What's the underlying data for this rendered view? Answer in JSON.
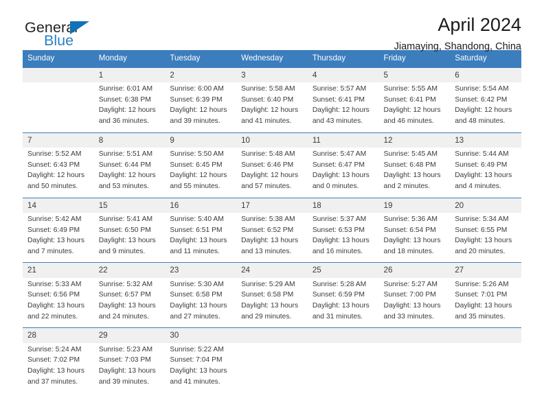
{
  "logo": {
    "word_top": "General",
    "word_bottom": "Blue",
    "triangle_color": "#1272b7",
    "blue_color": "#2980c4"
  },
  "header": {
    "title": "April 2024",
    "subtitle": "Jiamaying, Shandong, China"
  },
  "theme": {
    "header_bg": "#3b7dbd",
    "daynum_bg": "#f0f0f0",
    "text": "#3a3a3a"
  },
  "weekday_headers": [
    "Sunday",
    "Monday",
    "Tuesday",
    "Wednesday",
    "Thursday",
    "Friday",
    "Saturday"
  ],
  "labels": {
    "sunrise_prefix": "Sunrise:",
    "sunset_prefix": "Sunset:",
    "daylight_prefix": "Daylight:"
  },
  "weeks": [
    [
      {
        "day": "",
        "sunrise": "",
        "sunset": "",
        "daylight_line1": "",
        "daylight_line2": "",
        "blank": true
      },
      {
        "day": "1",
        "sunrise": "Sunrise: 6:01 AM",
        "sunset": "Sunset: 6:38 PM",
        "daylight_line1": "Daylight: 12 hours",
        "daylight_line2": "and 36 minutes."
      },
      {
        "day": "2",
        "sunrise": "Sunrise: 6:00 AM",
        "sunset": "Sunset: 6:39 PM",
        "daylight_line1": "Daylight: 12 hours",
        "daylight_line2": "and 39 minutes."
      },
      {
        "day": "3",
        "sunrise": "Sunrise: 5:58 AM",
        "sunset": "Sunset: 6:40 PM",
        "daylight_line1": "Daylight: 12 hours",
        "daylight_line2": "and 41 minutes."
      },
      {
        "day": "4",
        "sunrise": "Sunrise: 5:57 AM",
        "sunset": "Sunset: 6:41 PM",
        "daylight_line1": "Daylight: 12 hours",
        "daylight_line2": "and 43 minutes."
      },
      {
        "day": "5",
        "sunrise": "Sunrise: 5:55 AM",
        "sunset": "Sunset: 6:41 PM",
        "daylight_line1": "Daylight: 12 hours",
        "daylight_line2": "and 46 minutes."
      },
      {
        "day": "6",
        "sunrise": "Sunrise: 5:54 AM",
        "sunset": "Sunset: 6:42 PM",
        "daylight_line1": "Daylight: 12 hours",
        "daylight_line2": "and 48 minutes."
      }
    ],
    [
      {
        "day": "7",
        "sunrise": "Sunrise: 5:52 AM",
        "sunset": "Sunset: 6:43 PM",
        "daylight_line1": "Daylight: 12 hours",
        "daylight_line2": "and 50 minutes."
      },
      {
        "day": "8",
        "sunrise": "Sunrise: 5:51 AM",
        "sunset": "Sunset: 6:44 PM",
        "daylight_line1": "Daylight: 12 hours",
        "daylight_line2": "and 53 minutes."
      },
      {
        "day": "9",
        "sunrise": "Sunrise: 5:50 AM",
        "sunset": "Sunset: 6:45 PM",
        "daylight_line1": "Daylight: 12 hours",
        "daylight_line2": "and 55 minutes."
      },
      {
        "day": "10",
        "sunrise": "Sunrise: 5:48 AM",
        "sunset": "Sunset: 6:46 PM",
        "daylight_line1": "Daylight: 12 hours",
        "daylight_line2": "and 57 minutes."
      },
      {
        "day": "11",
        "sunrise": "Sunrise: 5:47 AM",
        "sunset": "Sunset: 6:47 PM",
        "daylight_line1": "Daylight: 13 hours",
        "daylight_line2": "and 0 minutes."
      },
      {
        "day": "12",
        "sunrise": "Sunrise: 5:45 AM",
        "sunset": "Sunset: 6:48 PM",
        "daylight_line1": "Daylight: 13 hours",
        "daylight_line2": "and 2 minutes."
      },
      {
        "day": "13",
        "sunrise": "Sunrise: 5:44 AM",
        "sunset": "Sunset: 6:49 PM",
        "daylight_line1": "Daylight: 13 hours",
        "daylight_line2": "and 4 minutes."
      }
    ],
    [
      {
        "day": "14",
        "sunrise": "Sunrise: 5:42 AM",
        "sunset": "Sunset: 6:49 PM",
        "daylight_line1": "Daylight: 13 hours",
        "daylight_line2": "and 7 minutes."
      },
      {
        "day": "15",
        "sunrise": "Sunrise: 5:41 AM",
        "sunset": "Sunset: 6:50 PM",
        "daylight_line1": "Daylight: 13 hours",
        "daylight_line2": "and 9 minutes."
      },
      {
        "day": "16",
        "sunrise": "Sunrise: 5:40 AM",
        "sunset": "Sunset: 6:51 PM",
        "daylight_line1": "Daylight: 13 hours",
        "daylight_line2": "and 11 minutes."
      },
      {
        "day": "17",
        "sunrise": "Sunrise: 5:38 AM",
        "sunset": "Sunset: 6:52 PM",
        "daylight_line1": "Daylight: 13 hours",
        "daylight_line2": "and 13 minutes."
      },
      {
        "day": "18",
        "sunrise": "Sunrise: 5:37 AM",
        "sunset": "Sunset: 6:53 PM",
        "daylight_line1": "Daylight: 13 hours",
        "daylight_line2": "and 16 minutes."
      },
      {
        "day": "19",
        "sunrise": "Sunrise: 5:36 AM",
        "sunset": "Sunset: 6:54 PM",
        "daylight_line1": "Daylight: 13 hours",
        "daylight_line2": "and 18 minutes."
      },
      {
        "day": "20",
        "sunrise": "Sunrise: 5:34 AM",
        "sunset": "Sunset: 6:55 PM",
        "daylight_line1": "Daylight: 13 hours",
        "daylight_line2": "and 20 minutes."
      }
    ],
    [
      {
        "day": "21",
        "sunrise": "Sunrise: 5:33 AM",
        "sunset": "Sunset: 6:56 PM",
        "daylight_line1": "Daylight: 13 hours",
        "daylight_line2": "and 22 minutes."
      },
      {
        "day": "22",
        "sunrise": "Sunrise: 5:32 AM",
        "sunset": "Sunset: 6:57 PM",
        "daylight_line1": "Daylight: 13 hours",
        "daylight_line2": "and 24 minutes."
      },
      {
        "day": "23",
        "sunrise": "Sunrise: 5:30 AM",
        "sunset": "Sunset: 6:58 PM",
        "daylight_line1": "Daylight: 13 hours",
        "daylight_line2": "and 27 minutes."
      },
      {
        "day": "24",
        "sunrise": "Sunrise: 5:29 AM",
        "sunset": "Sunset: 6:58 PM",
        "daylight_line1": "Daylight: 13 hours",
        "daylight_line2": "and 29 minutes."
      },
      {
        "day": "25",
        "sunrise": "Sunrise: 5:28 AM",
        "sunset": "Sunset: 6:59 PM",
        "daylight_line1": "Daylight: 13 hours",
        "daylight_line2": "and 31 minutes."
      },
      {
        "day": "26",
        "sunrise": "Sunrise: 5:27 AM",
        "sunset": "Sunset: 7:00 PM",
        "daylight_line1": "Daylight: 13 hours",
        "daylight_line2": "and 33 minutes."
      },
      {
        "day": "27",
        "sunrise": "Sunrise: 5:26 AM",
        "sunset": "Sunset: 7:01 PM",
        "daylight_line1": "Daylight: 13 hours",
        "daylight_line2": "and 35 minutes."
      }
    ],
    [
      {
        "day": "28",
        "sunrise": "Sunrise: 5:24 AM",
        "sunset": "Sunset: 7:02 PM",
        "daylight_line1": "Daylight: 13 hours",
        "daylight_line2": "and 37 minutes."
      },
      {
        "day": "29",
        "sunrise": "Sunrise: 5:23 AM",
        "sunset": "Sunset: 7:03 PM",
        "daylight_line1": "Daylight: 13 hours",
        "daylight_line2": "and 39 minutes."
      },
      {
        "day": "30",
        "sunrise": "Sunrise: 5:22 AM",
        "sunset": "Sunset: 7:04 PM",
        "daylight_line1": "Daylight: 13 hours",
        "daylight_line2": "and 41 minutes."
      },
      {
        "day": "",
        "sunrise": "",
        "sunset": "",
        "daylight_line1": "",
        "daylight_line2": "",
        "blank": true
      },
      {
        "day": "",
        "sunrise": "",
        "sunset": "",
        "daylight_line1": "",
        "daylight_line2": "",
        "blank": true
      },
      {
        "day": "",
        "sunrise": "",
        "sunset": "",
        "daylight_line1": "",
        "daylight_line2": "",
        "blank": true
      },
      {
        "day": "",
        "sunrise": "",
        "sunset": "",
        "daylight_line1": "",
        "daylight_line2": "",
        "blank": true
      }
    ]
  ]
}
